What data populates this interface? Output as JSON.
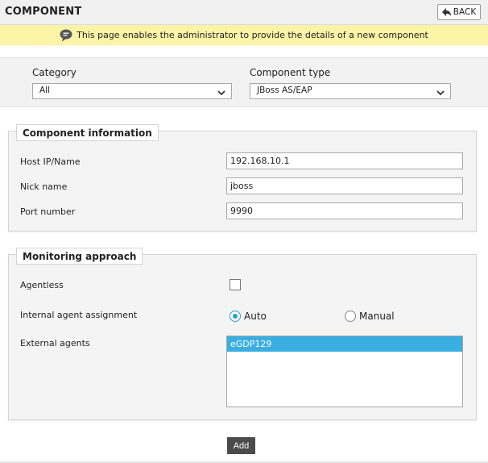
{
  "header": {
    "title": "COMPONENT",
    "back_label": "BACK"
  },
  "info": {
    "message": "This page enables the administrator to provide the details of a new component"
  },
  "selectors": {
    "category": {
      "label": "Category",
      "value": "All"
    },
    "component_type": {
      "label": "Component type",
      "value": "JBoss AS/EAP"
    }
  },
  "component_info": {
    "title": "Component information",
    "fields": [
      {
        "label": "Host IP/Name",
        "value": "192.168.10.1"
      },
      {
        "label": "Nick name",
        "value": "jboss"
      },
      {
        "label": "Port number",
        "value": "9990"
      }
    ]
  },
  "monitoring": {
    "title": "Monitoring approach",
    "agentless": {
      "label": "Agentless",
      "checked": false
    },
    "internal_agent": {
      "label": "Internal agent assignment",
      "options": [
        "Auto",
        "Manual"
      ],
      "selected": "Auto"
    },
    "external_agents": {
      "label": "External agents",
      "items": [
        "eGDP129"
      ],
      "selected": "eGDP129"
    }
  },
  "actions": {
    "add_label": "Add"
  },
  "colors": {
    "accent": "#2a9fd6",
    "info_bar": "#fbf3a5",
    "list_selected": "#3aaee0",
    "add_button": "#4b4b4b"
  }
}
